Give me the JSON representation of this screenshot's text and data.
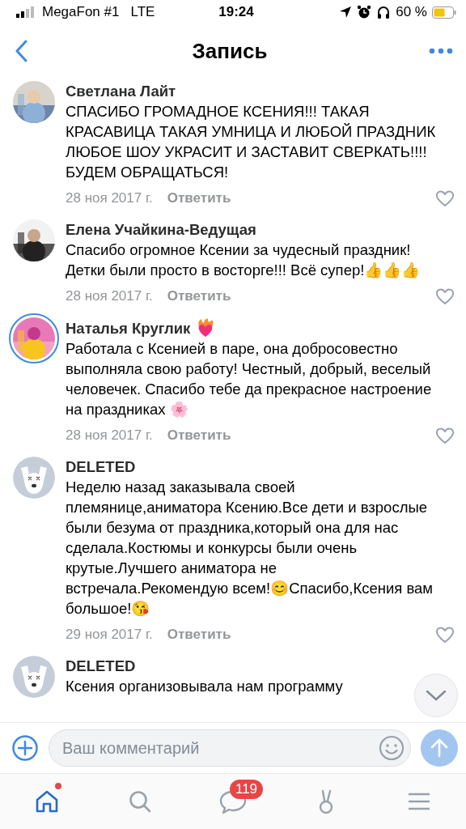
{
  "status_bar": {
    "carrier": "MegaFon #1",
    "network": "LTE",
    "time": "19:24",
    "battery": "60 %"
  },
  "header": {
    "title": "Запись"
  },
  "comments": [
    {
      "author": "Светлана Лайт",
      "story_ring": false,
      "badge": false,
      "text": "СПАСИБО ГРОМАДНОЕ КСЕНИЯ!!! ТАКАЯ КРАСАВИЦА ТАКАЯ УМНИЦА И ЛЮБОЙ ПРАЗДНИК ЛЮБОЕ ШОУ УКРАСИТ И ЗАСТАВИТ СВЕРКАТЬ!!!! БУДЕМ ОБРАЩАТЬСЯ!",
      "date": "28 ноя 2017 г.",
      "reply": "Ответить"
    },
    {
      "author": "Елена Учайкина-Ведущая",
      "story_ring": false,
      "badge": false,
      "text": "Спасибо огромное Ксении за чудесный праздник! Детки были просто в восторге!!! Всё супер!👍👍👍",
      "date": "28 ноя 2017 г.",
      "reply": "Ответить"
    },
    {
      "author": "Наталья Круглик",
      "story_ring": true,
      "badge": true,
      "text": "Работала с Ксенией в паре, она добросовестно выполняла свою работу! Честный, добрый, веселый человечек. Спасибо тебе да прекрасное настроение на праздниках 🌸",
      "date": "28 ноя 2017 г.",
      "reply": "Ответить"
    },
    {
      "author": "DELETED",
      "kind": "deleted",
      "story_ring": false,
      "badge": false,
      "text": "Неделю назад заказывала своей племянице,аниматора Ксению.Все дети и взрослые были безума от праздника,который она для нас сделала.Костюмы и конкурсы были очень крутые.Лучшего аниматора не встречала.Рекомендую всем!😊Спасибо,Ксения вам большое!😘",
      "date": "29 ноя 2017 г.",
      "reply": "Ответить"
    },
    {
      "author": "DELETED",
      "kind": "deleted",
      "story_ring": false,
      "badge": false,
      "text": "Ксения организовывала нам программу"
    }
  ],
  "composer": {
    "placeholder": "Ваш комментарий"
  },
  "tab_bar": [
    {
      "kind": "home",
      "selected": true,
      "dot": true
    },
    {
      "kind": "search",
      "selected": false
    },
    {
      "kind": "messages",
      "selected": false,
      "badge": "119"
    },
    {
      "kind": "friends",
      "selected": false
    },
    {
      "kind": "menu",
      "selected": false
    }
  ]
}
